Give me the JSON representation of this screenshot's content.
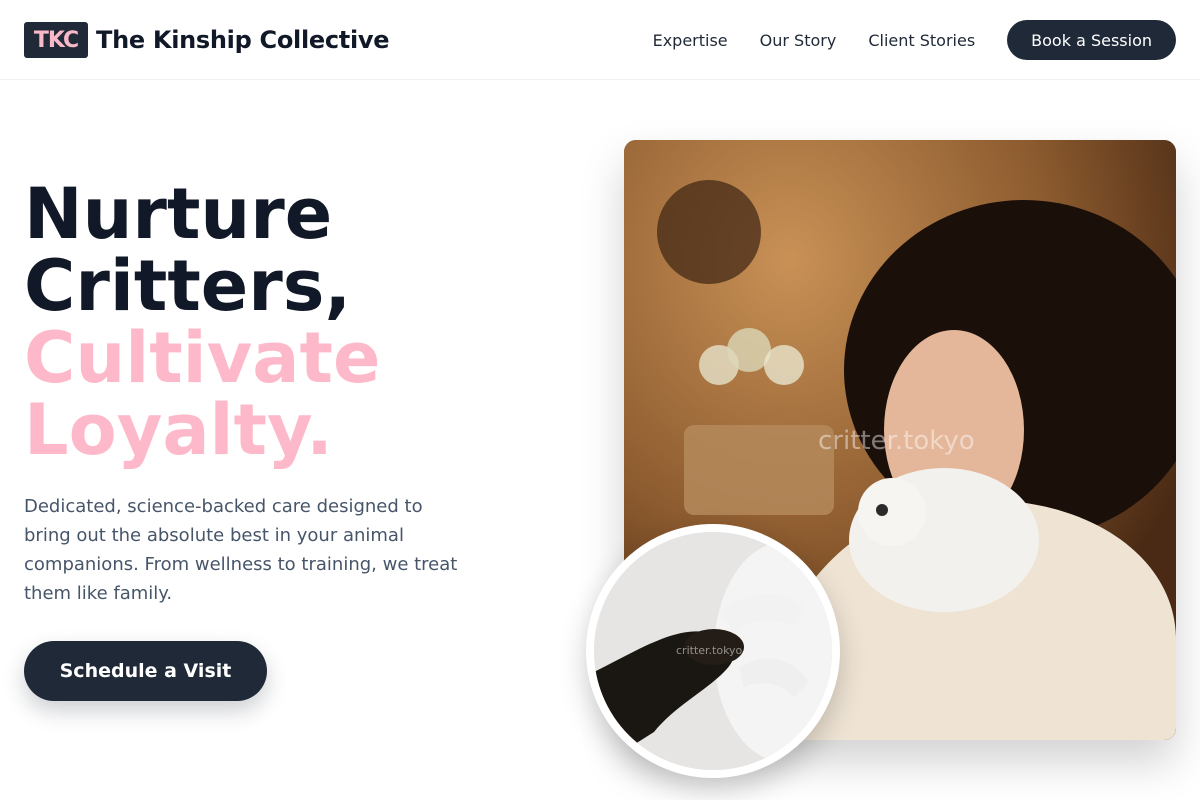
{
  "header": {
    "logo_badge": "TKC",
    "brand_name": "The Kinship Collective",
    "nav": [
      "Expertise",
      "Our Story",
      "Client Stories"
    ],
    "cta_label": "Book a Session"
  },
  "hero": {
    "headline_line1": "Nurture",
    "headline_line2": "Critters,",
    "headline_line3": "Cultivate",
    "headline_line4": "Loyalty.",
    "description": "Dedicated, science-backed care designed to bring out the absolute best in your animal companions. From wellness to training, we treat them like family.",
    "cta_label": "Schedule a Visit",
    "photo_watermark": "critter.tokyo",
    "circle_watermark": "critter.tokyo"
  },
  "colors": {
    "primary_dark": "#1f2937",
    "accent_pink": "#fdb9c9"
  }
}
